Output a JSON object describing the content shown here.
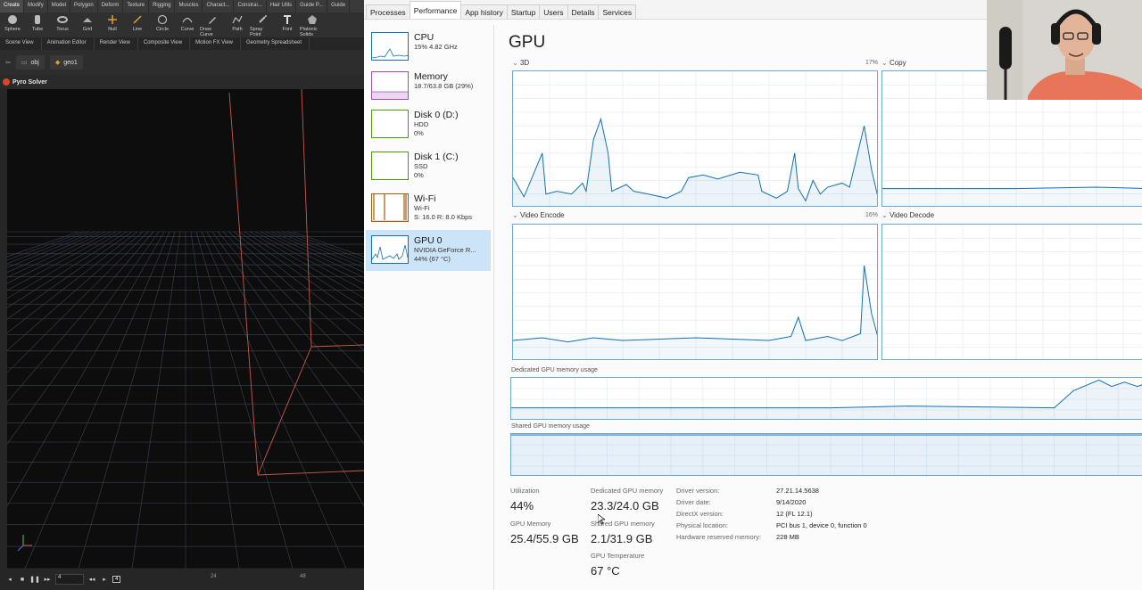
{
  "houdini": {
    "shelf_tabs": [
      "Create",
      "Modify",
      "Model",
      "Polygon",
      "Deform",
      "Texture",
      "Rigging",
      "Muscles",
      "Charact...",
      "Constrai...",
      "Hair Utils",
      "Guide P...",
      "Guide"
    ],
    "tools": [
      "Sphere",
      "Tube",
      "Torus",
      "Grid",
      "Null",
      "Line",
      "Circle",
      "Curve",
      "Draw Curve",
      "Path",
      "Spray Point",
      "Font",
      "Platonic Solids"
    ],
    "pane_tabs": [
      "Scene View",
      "Animation Editor",
      "Render View",
      "Composite View",
      "Motion FX View",
      "Geometry Spreadsheet"
    ],
    "path": {
      "root": "obj",
      "node": "geo1"
    },
    "viewport_title": "Pyro Solver",
    "timeline": {
      "frame": "4",
      "marker": "4",
      "tick_a": "24",
      "tick_b": "48"
    }
  },
  "taskmgr": {
    "tabs": [
      "Processes",
      "Performance",
      "App history",
      "Startup",
      "Users",
      "Details",
      "Services"
    ],
    "active_tab": "Performance",
    "sidebar": [
      {
        "name": "CPU",
        "line1": "15% 4.82 GHz",
        "line2": "",
        "color": "#1170b8"
      },
      {
        "name": "Memory",
        "line1": "18.7/63.8 GB (29%)",
        "line2": "",
        "color": "#9c4fb4"
      },
      {
        "name": "Disk 0 (D:)",
        "line1": "HDD",
        "line2": "0%",
        "color": "#4e9a06"
      },
      {
        "name": "Disk 1 (C:)",
        "line1": "SSD",
        "line2": "0%",
        "color": "#4e9a06"
      },
      {
        "name": "Wi-Fi",
        "line1": "Wi-Fi",
        "line2": "S: 16.0  R: 8.0 Kbps",
        "color": "#a75a0a"
      },
      {
        "name": "GPU 0",
        "line1": "NVIDIA GeForce R...",
        "line2": "44% (67 °C)",
        "color": "#1170b8"
      }
    ],
    "title": "GPU",
    "graphs": {
      "g3d": {
        "label": "3D",
        "pct": "17%"
      },
      "copy": {
        "label": "Copy"
      },
      "venc": {
        "label": "Video Encode",
        "pct": "16%"
      },
      "vdec": {
        "label": "Video Decode"
      }
    },
    "dedicated_label": "Dedicated GPU memory usage",
    "shared_label": "Shared GPU memory usage",
    "stats": {
      "util_label": "Utilization",
      "util": "44%",
      "ded_label": "Dedicated GPU memory",
      "ded": "23.3/24.0 GB",
      "gpumem_label": "GPU Memory",
      "gpumem": "25.4/55.9 GB",
      "shared_label": "Shared GPU memory",
      "shared": "2.1/31.9 GB",
      "temp_label": "GPU Temperature",
      "temp": "67 °C"
    },
    "props": [
      {
        "k": "Driver version:",
        "v": "27.21.14.5638"
      },
      {
        "k": "Driver date:",
        "v": "9/14/2020"
      },
      {
        "k": "DirectX version:",
        "v": "12 (FL 12.1)"
      },
      {
        "k": "Physical location:",
        "v": "PCI bus 1, device 0, function 0"
      },
      {
        "k": "Hardware reserved memory:",
        "v": "228 MB"
      }
    ],
    "colors": {
      "gpu_line": "#1170b8",
      "grid": "#e6eef6"
    }
  }
}
